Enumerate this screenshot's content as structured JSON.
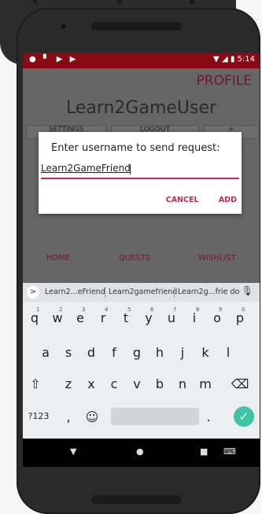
{
  "status_bar": {
    "time": "5:14"
  },
  "app": {
    "header": {
      "title": "PROFILE"
    },
    "username": "Learn2GameUser",
    "buttons": [
      "SETTINGS",
      "LOGOUT",
      "+"
    ],
    "bottom_nav": [
      "HOME",
      "QUESTS",
      "WISHLIST"
    ]
  },
  "dialog": {
    "title": "Enter username to send request:",
    "input_value": "Learn2GameFriend",
    "cancel_label": "CANCEL",
    "add_label": "ADD"
  },
  "keyboard": {
    "suggestions": [
      "Learn2...eFriend",
      "Learn2gamefriend",
      "Learn2g...frie do"
    ],
    "row1": [
      "q",
      "w",
      "e",
      "r",
      "t",
      "y",
      "u",
      "i",
      "o",
      "p"
    ],
    "row1_hints": [
      "1",
      "2",
      "3",
      "4",
      "5",
      "6",
      "7",
      "8",
      "9",
      "0"
    ],
    "row2": [
      "a",
      "s",
      "d",
      "f",
      "g",
      "h",
      "j",
      "k",
      "l"
    ],
    "row3": [
      "z",
      "x",
      "c",
      "v",
      "b",
      "n",
      "m"
    ],
    "symbols_label": "?123",
    "comma": ",",
    "period": "."
  },
  "colors": {
    "accent": "#c4285f",
    "status_bar": "#8a0a13",
    "enter_key": "#3ec3a4"
  }
}
